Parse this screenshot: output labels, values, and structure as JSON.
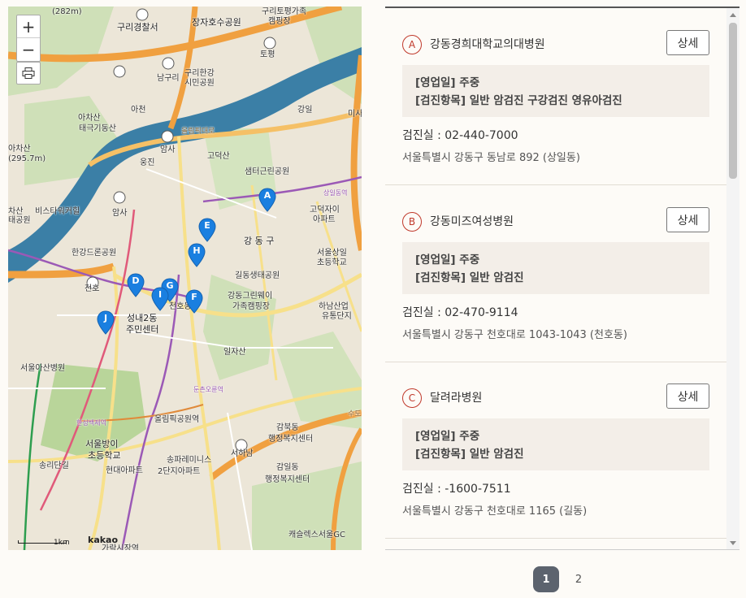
{
  "map": {
    "zoom_in": "+",
    "zoom_out": "−",
    "print_icon": "printer-icon",
    "scale_label": "1km",
    "logo": "kakao",
    "labels": [
      {
        "id": "l1",
        "text": "(282m)"
      },
      {
        "id": "l2",
        "text": "장자호수공원"
      },
      {
        "id": "l3",
        "text": "구리토평가족"
      },
      {
        "id": "l4",
        "text": "캠핑장"
      },
      {
        "id": "l5",
        "text": "구리경찰서"
      },
      {
        "id": "l6",
        "text": "토평"
      },
      {
        "id": "l7",
        "text": "남구리"
      },
      {
        "id": "l8",
        "text": "구리한강"
      },
      {
        "id": "l9",
        "text": "시민공원"
      },
      {
        "id": "l10",
        "text": "아천"
      },
      {
        "id": "l11",
        "text": "강일"
      },
      {
        "id": "l12",
        "text": "미사"
      },
      {
        "id": "l13",
        "text": "아차산"
      },
      {
        "id": "l14",
        "text": "태극기동산"
      },
      {
        "id": "l15",
        "text": "아차산"
      },
      {
        "id": "l16",
        "text": "(295.7m)"
      },
      {
        "id": "l17",
        "text": "올림픽대로"
      },
      {
        "id": "l18",
        "text": "암사"
      },
      {
        "id": "l19",
        "text": "고덕산"
      },
      {
        "id": "l20",
        "text": "웅진"
      },
      {
        "id": "l21",
        "text": "샘터근린공원"
      },
      {
        "id": "l22",
        "text": "상일동역"
      },
      {
        "id": "l23",
        "text": "차산"
      },
      {
        "id": "l24",
        "text": "태공원"
      },
      {
        "id": "l25",
        "text": "비스타워커힐"
      },
      {
        "id": "l26",
        "text": "암사"
      },
      {
        "id": "l27",
        "text": "고덕자이"
      },
      {
        "id": "l28",
        "text": "아파트"
      },
      {
        "id": "l29",
        "text": "강 동 구"
      },
      {
        "id": "l30",
        "text": "한강드론공원"
      },
      {
        "id": "l31",
        "text": "서울상일"
      },
      {
        "id": "l32",
        "text": "초등학교"
      },
      {
        "id": "l33",
        "text": "길동생태공원"
      },
      {
        "id": "l34",
        "text": "천호"
      },
      {
        "id": "l35",
        "text": "강동그린웨이"
      },
      {
        "id": "l36",
        "text": "가족캠핑장"
      },
      {
        "id": "l37",
        "text": "하남산업"
      },
      {
        "id": "l38",
        "text": "유통단지"
      },
      {
        "id": "l39",
        "text": "성내2동"
      },
      {
        "id": "l40",
        "text": "주민센터"
      },
      {
        "id": "l41",
        "text": "일자산"
      },
      {
        "id": "l42",
        "text": "서울아산병원"
      },
      {
        "id": "l43",
        "text": "둔촌오륜역"
      },
      {
        "id": "l44",
        "text": "올림픽공원역"
      },
      {
        "id": "l45",
        "text": "감북동"
      },
      {
        "id": "l46",
        "text": "행정복지센터"
      },
      {
        "id": "l47",
        "text": "서울방이"
      },
      {
        "id": "l48",
        "text": "초등학교"
      },
      {
        "id": "l49",
        "text": "서하남"
      },
      {
        "id": "l50",
        "text": "송리단길"
      },
      {
        "id": "l51",
        "text": "현대아파트"
      },
      {
        "id": "l52",
        "text": "송파레미니스"
      },
      {
        "id": "l53",
        "text": "2단지아파트"
      },
      {
        "id": "l54",
        "text": "감일동"
      },
      {
        "id": "l55",
        "text": "행정복지센터"
      },
      {
        "id": "l56",
        "text": "캐슬렉스서울GC"
      },
      {
        "id": "l57",
        "text": "수도권"
      },
      {
        "id": "l58",
        "text": "한성백제역"
      },
      {
        "id": "l59",
        "text": "천호동"
      },
      {
        "id": "l60",
        "text": "가락시장역"
      }
    ],
    "pins": [
      {
        "letter": "A"
      },
      {
        "letter": "E"
      },
      {
        "letter": "H"
      },
      {
        "letter": "D"
      },
      {
        "letter": "G"
      },
      {
        "letter": "I"
      },
      {
        "letter": "F"
      },
      {
        "letter": "J"
      }
    ]
  },
  "items": [
    {
      "badge": "A",
      "name": "강동경희대학교의대병원",
      "detail_label": "상세",
      "hours": "[영업일] 주중",
      "checkup": "[검진항목] 일반 암검진 구강검진 영유아검진",
      "phone": "검진실 :  02-440-7000",
      "address": "서울특별시 강동구 동남로 892 (상일동)"
    },
    {
      "badge": "B",
      "name": "강동미즈여성병원",
      "detail_label": "상세",
      "hours": "[영업일] 주중",
      "checkup": "[검진항목] 일반 암검진",
      "phone": "검진실 :  02-470-9114",
      "address": "서울특별시 강동구 천호대로 1043-1043 (천호동)"
    },
    {
      "badge": "C",
      "name": "달려라병원",
      "detail_label": "상세",
      "hours": "[영업일] 주중",
      "checkup": "[검진항목] 일반 암검진",
      "phone": "검진실 :  -1600-7511",
      "address": "서울특별시 강동구 천호대로 1165 (길동)"
    }
  ],
  "pagination": {
    "pages": [
      "1",
      "2"
    ],
    "current": "1"
  },
  "colors": {
    "pin": "#1a7fe0",
    "badge": "#c0392b",
    "page_active": "#5c636e",
    "river": "#3b7fa6",
    "expressway": "#f0a040"
  }
}
